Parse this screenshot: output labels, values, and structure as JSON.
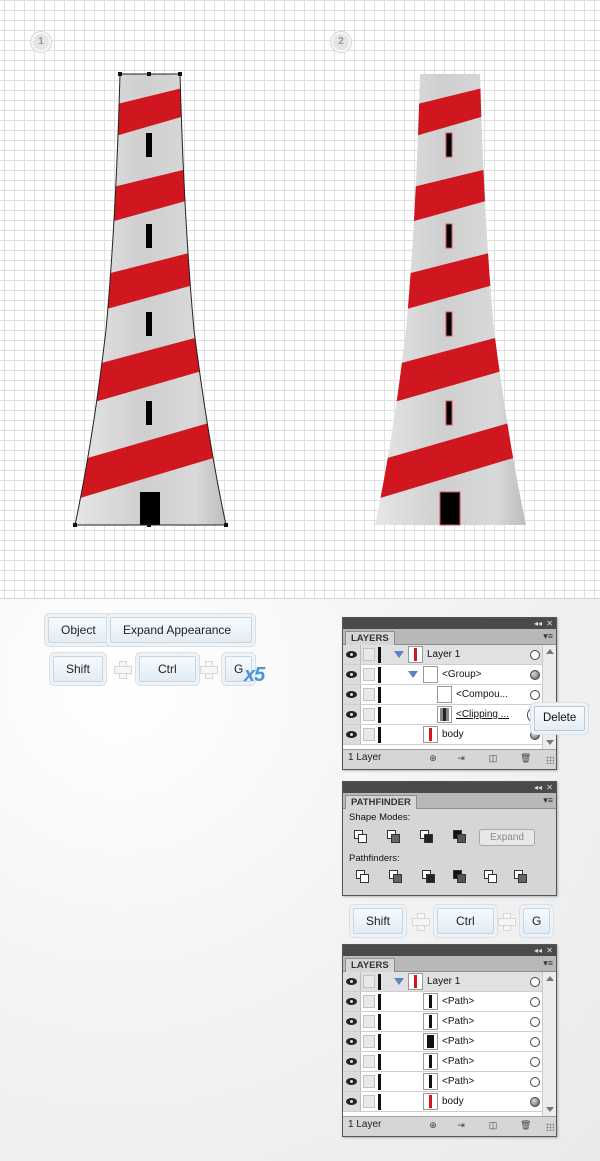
{
  "steps": [
    "1",
    "2"
  ],
  "instructions_top": {
    "menu": [
      "Object",
      "Expand Appearance"
    ],
    "keys": [
      "Shift",
      "Ctrl",
      "G"
    ],
    "repeat": "x5"
  },
  "instructions_mid": {
    "keys": [
      "Shift",
      "Ctrl",
      "G"
    ]
  },
  "layers_panel_1": {
    "tab": "LAYERS",
    "rows": [
      {
        "label": "Layer 1"
      },
      {
        "label": "<Group>"
      },
      {
        "label": "<Compou..."
      },
      {
        "label": "<Clipping ..."
      },
      {
        "label": "body"
      }
    ],
    "footer": "1 Layer",
    "context_button": "Delete"
  },
  "pathfinder_panel": {
    "tab": "PATHFINDER",
    "shape_modes_label": "Shape Modes:",
    "pathfinders_label": "Pathfinders:",
    "expand_button": "Expand"
  },
  "layers_panel_2": {
    "tab": "LAYERS",
    "rows": [
      {
        "label": "Layer 1"
      },
      {
        "label": "<Path>"
      },
      {
        "label": "<Path>"
      },
      {
        "label": "<Path>"
      },
      {
        "label": "<Path>"
      },
      {
        "label": "<Path>"
      },
      {
        "label": "body"
      }
    ],
    "footer": "1 Layer"
  },
  "colors": {
    "stripe_red": "#d0161e",
    "body_gray": "#dcdcdc",
    "key_bg": "#e8f0f7",
    "accent_blue": "#4a95d6"
  }
}
